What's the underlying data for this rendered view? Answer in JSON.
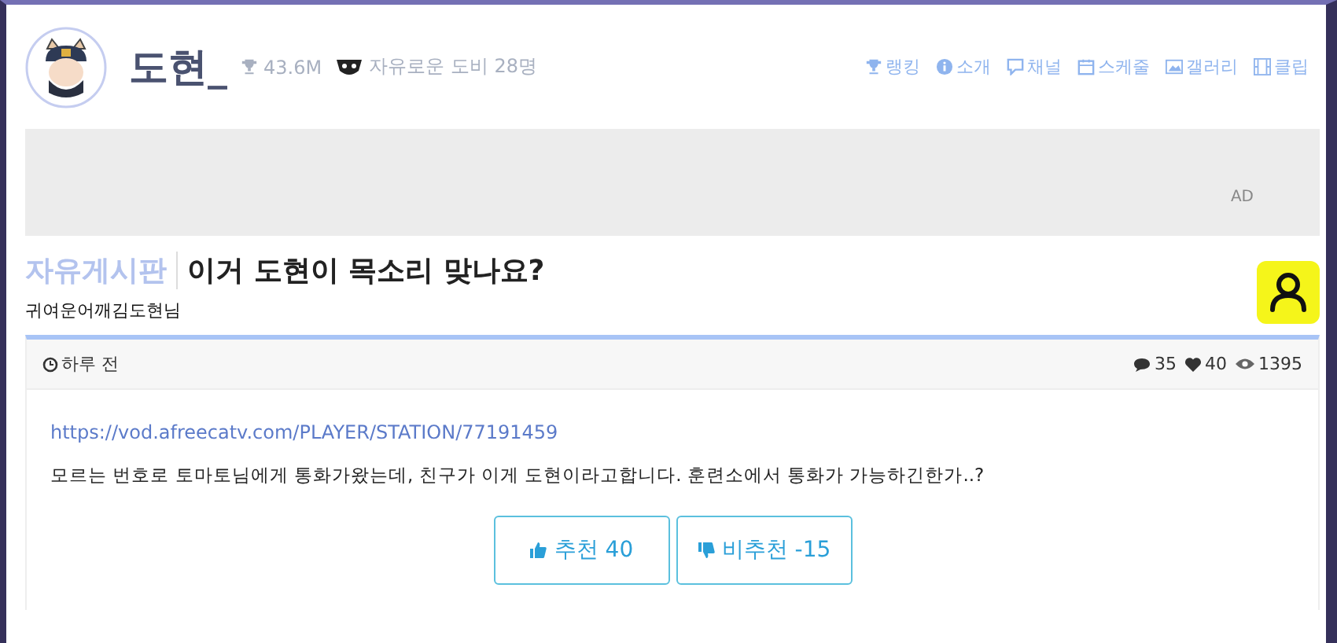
{
  "profile": {
    "name": "도현_",
    "trophy_score": "43.6M",
    "fan_group": "자유로운 도비 28명"
  },
  "nav": [
    {
      "label": "랭킹",
      "kind": "trophy"
    },
    {
      "label": "소개",
      "kind": "info"
    },
    {
      "label": "채널",
      "kind": "chat"
    },
    {
      "label": "스케줄",
      "kind": "calendar"
    },
    {
      "label": "갤러리",
      "kind": "image"
    },
    {
      "label": "클립",
      "kind": "film"
    }
  ],
  "ad": {
    "label": "AD"
  },
  "post": {
    "board": "자유게시판",
    "title": "이거 도현이 목소리 맞나요?",
    "author": "귀여운어깨김도현님",
    "time": "하루 전",
    "comments": "35",
    "likes": "40",
    "views": "1395",
    "link": "https://vod.afreecatv.com/PLAYER/STATION/77191459",
    "body": "모르는 번호로 토마토님에게 통화가왔는데, 친구가 이게 도현이라고합니다. 훈련소에서 통화가 가능하긴한가..?"
  },
  "votes": [
    {
      "kind": "up",
      "label": "추천 40"
    },
    {
      "kind": "down",
      "label": "비추천 -15"
    }
  ]
}
